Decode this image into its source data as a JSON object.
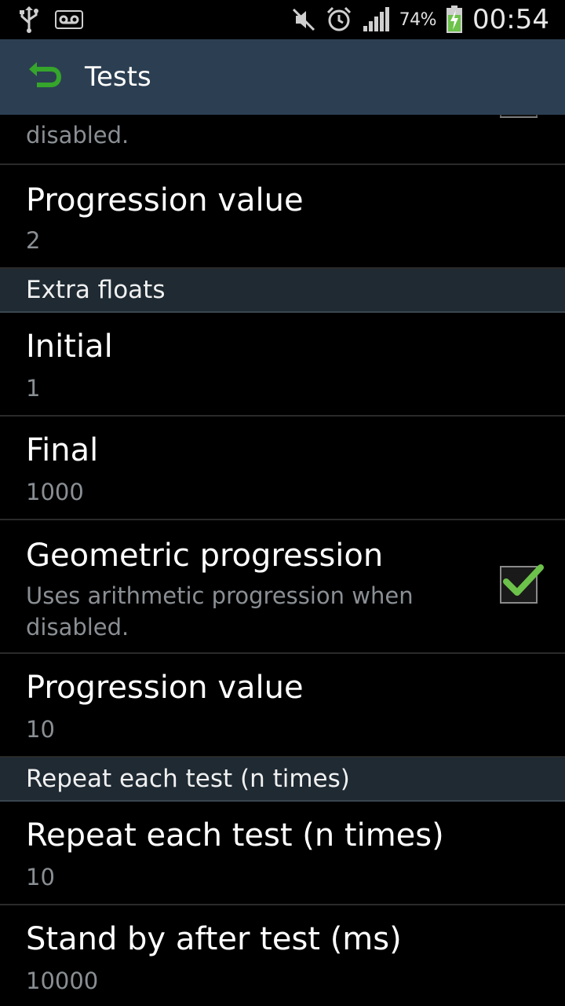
{
  "status_bar": {
    "icons": [
      "usb-icon",
      "voicemail-icon",
      "mute-icon",
      "alarm-icon",
      "signal-icon",
      "battery-charging-icon"
    ],
    "battery_percent": "74%",
    "time": "00:54"
  },
  "action_bar": {
    "title": "Tests",
    "back_icon": "back-arrow-icon",
    "accent_color": "#35a52b"
  },
  "list": {
    "partial_item_summary": "disabled.",
    "items_top": [
      {
        "title": "Progression value",
        "summary": "2"
      }
    ],
    "section_extra_floats": "Extra floats",
    "extra_floats": {
      "initial": {
        "title": "Initial",
        "summary": "1"
      },
      "final": {
        "title": "Final",
        "summary": "1000"
      },
      "geometric": {
        "title": "Geometric progression",
        "summary": "Uses arithmetic progression when disabled.",
        "checked": true
      },
      "progression": {
        "title": "Progression value",
        "summary": "10"
      }
    },
    "section_repeat": "Repeat each test (n times)",
    "repeat": {
      "repeat_item": {
        "title": "Repeat each test (n times)",
        "summary": "10"
      },
      "standby_item": {
        "title": "Stand by after test (ms)",
        "summary": "10000"
      }
    }
  }
}
